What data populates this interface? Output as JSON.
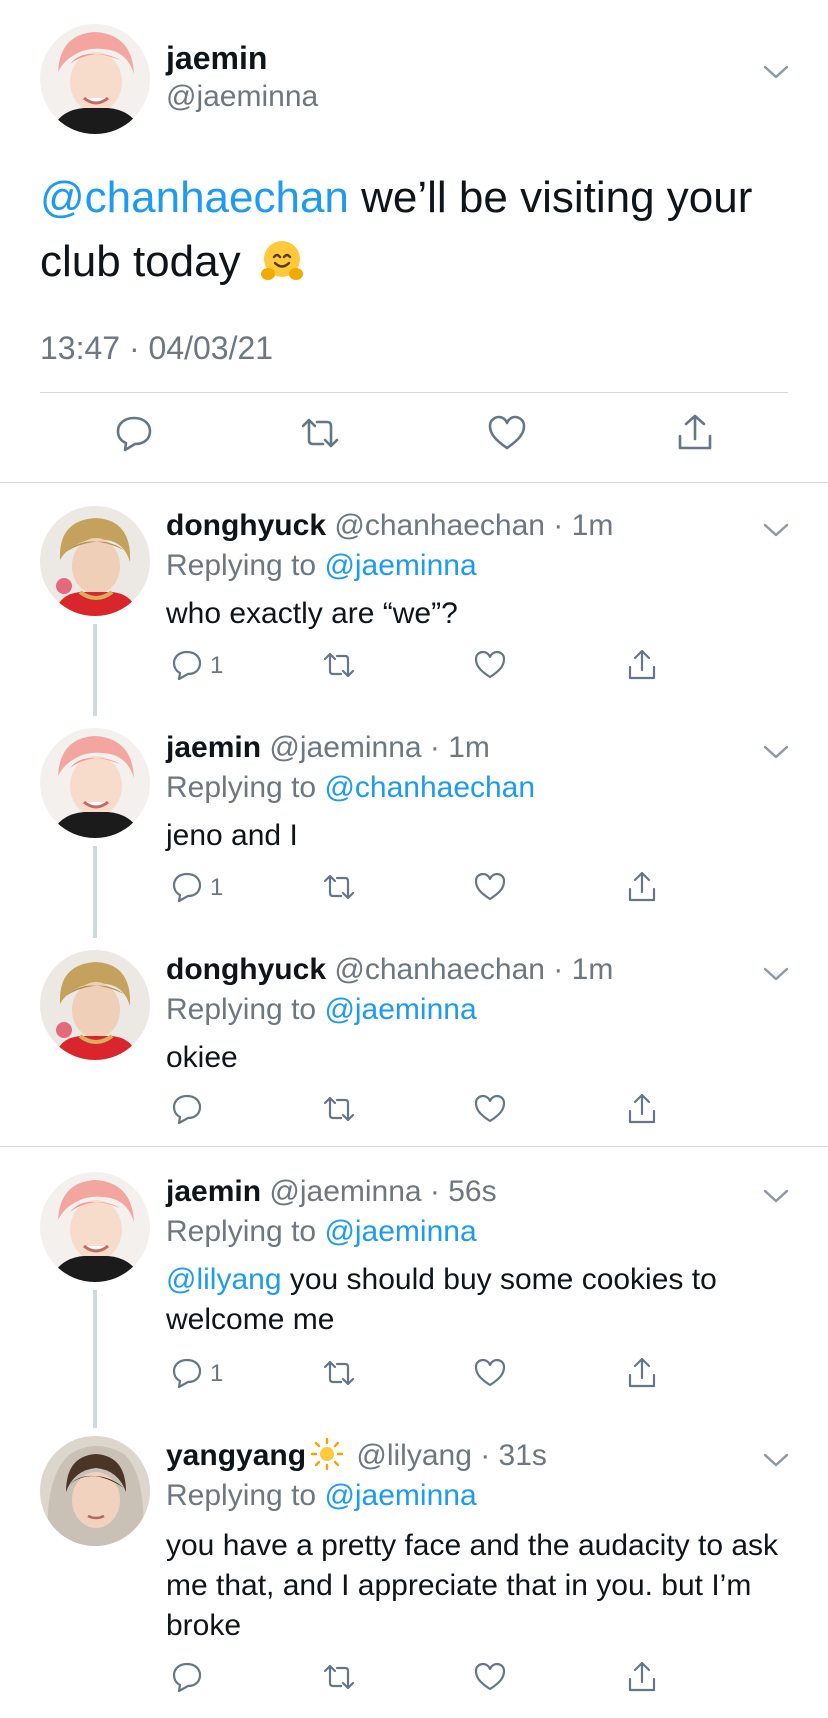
{
  "main_tweet": {
    "name": "jaemin",
    "handle": "@jaeminna",
    "mention": "@chanhaechan",
    "text": " we’ll be visiting your club today",
    "emoji": "hugging-face-emoji",
    "timestamp": "13:47 · 04/03/21"
  },
  "replies": [
    {
      "name": "donghyuck",
      "meta": "@chanhaechan · 1m",
      "replying_prefix": "Replying to ",
      "replying_to": "@jaeminna",
      "text": "who exactly are “we”?",
      "reply_count": "1"
    },
    {
      "name": "jaemin",
      "meta": "@jaeminna · 1m",
      "replying_prefix": "Replying to ",
      "replying_to": "@chanhaechan",
      "text": "jeno and I",
      "reply_count": "1"
    },
    {
      "name": "donghyuck",
      "meta": "@chanhaechan · 1m",
      "replying_prefix": "Replying to ",
      "replying_to": "@jaeminna",
      "text": "okiee",
      "reply_count": ""
    },
    {
      "name": "jaemin",
      "meta": "@jaeminna · 56s",
      "replying_prefix": "Replying to ",
      "replying_to": "@jaeminna",
      "mention": "@lilyang",
      "text": " you should buy some cookies to welcome me",
      "reply_count": "1"
    },
    {
      "name": "yangyang",
      "meta": "@lilyang · 31s",
      "replying_prefix": "Replying to ",
      "replying_to": "@jaeminna",
      "text": "you have a pretty face and the audacity to ask me that, and I appreciate that in you. but I’m broke",
      "reply_count": "",
      "name_emoji": "sun-emoji"
    }
  ],
  "colors": {
    "link": "#1d9bf0",
    "muted": "#6e7680",
    "text": "#0f1419",
    "divider": "#cfd9de"
  },
  "icons": [
    "reply-icon",
    "retweet-icon",
    "like-icon",
    "share-icon",
    "chevron-down-icon"
  ]
}
